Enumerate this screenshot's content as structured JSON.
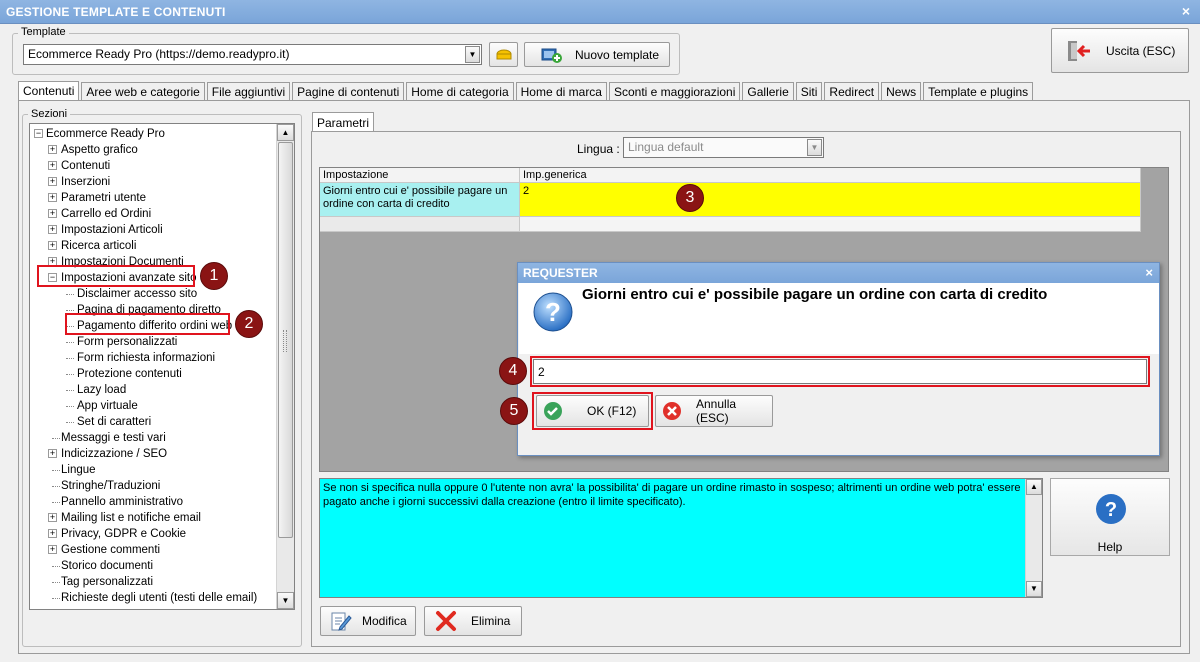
{
  "window": {
    "title": "GESTIONE TEMPLATE E CONTENUTI",
    "close_glyph": "×"
  },
  "template_group": {
    "label": "Template",
    "selected": "Ecommerce Ready Pro (https://demo.readypro.it)",
    "new_template_label": "Nuovo template"
  },
  "exit_button": {
    "label": "Uscita (ESC)"
  },
  "tabs": [
    {
      "label": "Contenuti",
      "active": true
    },
    {
      "label": "Aree web e categorie"
    },
    {
      "label": "File aggiuntivi"
    },
    {
      "label": "Pagine di contenuti"
    },
    {
      "label": "Home di categoria"
    },
    {
      "label": "Home di marca"
    },
    {
      "label": "Sconti e maggiorazioni"
    },
    {
      "label": "Gallerie"
    },
    {
      "label": "Siti"
    },
    {
      "label": "Redirect"
    },
    {
      "label": "News"
    },
    {
      "label": "Template e plugins"
    }
  ],
  "sections": {
    "label": "Sezioni",
    "tree": [
      {
        "label": "Ecommerce Ready Pro",
        "level": 0,
        "expander": "⊟"
      },
      {
        "label": "Aspetto grafico",
        "level": 1,
        "expander": "⊞"
      },
      {
        "label": "Contenuti",
        "level": 1,
        "expander": "⊞"
      },
      {
        "label": "Inserzioni",
        "level": 1,
        "expander": "⊞"
      },
      {
        "label": "Parametri utente",
        "level": 1,
        "expander": "⊞"
      },
      {
        "label": "Carrello ed Ordini",
        "level": 1,
        "expander": "⊞"
      },
      {
        "label": "Impostazioni Articoli",
        "level": 1,
        "expander": "⊞"
      },
      {
        "label": "Ricerca articoli",
        "level": 1,
        "expander": "⊞"
      },
      {
        "label": "Impostazioni Documenti",
        "level": 1,
        "expander": "⊞"
      },
      {
        "label": "Impostazioni avanzate sito",
        "level": 1,
        "expander": "⊟"
      },
      {
        "label": "Disclaimer accesso sito",
        "level": 2
      },
      {
        "label": "Pagina di pagamento diretto",
        "level": 2
      },
      {
        "label": "Pagamento differito ordini web",
        "level": 2
      },
      {
        "label": "Form personalizzati",
        "level": 2
      },
      {
        "label": "Form richiesta informazioni",
        "level": 2
      },
      {
        "label": "Protezione contenuti",
        "level": 2
      },
      {
        "label": "Lazy load",
        "level": 2
      },
      {
        "label": "App virtuale",
        "level": 2
      },
      {
        "label": "Set di caratteri",
        "level": 2
      },
      {
        "label": "Messaggi e testi vari",
        "level": 1
      },
      {
        "label": "Indicizzazione / SEO",
        "level": 1,
        "expander": "⊞"
      },
      {
        "label": "Lingue",
        "level": 1
      },
      {
        "label": "Stringhe/Traduzioni",
        "level": 1
      },
      {
        "label": "Pannello amministrativo",
        "level": 1
      },
      {
        "label": "Mailing list e notifiche email",
        "level": 1,
        "expander": "⊞"
      },
      {
        "label": "Privacy, GDPR e Cookie",
        "level": 1,
        "expander": "⊞"
      },
      {
        "label": "Gestione commenti",
        "level": 1,
        "expander": "⊞"
      },
      {
        "label": "Storico documenti",
        "level": 1
      },
      {
        "label": "Tag personalizzati",
        "level": 1
      },
      {
        "label": "Richieste degli utenti (testi delle email)",
        "level": 1
      }
    ]
  },
  "params": {
    "tab_label": "Parametri",
    "lingua_label": "Lingua :",
    "lingua_value": "Lingua default",
    "col_setting": "Impostazione",
    "col_value": "Imp.generica",
    "row_setting": "Giorni entro cui e' possibile pagare un ordine con carta di credito",
    "row_value": "2"
  },
  "dialog": {
    "title": "REQUESTER",
    "question": "Giorni entro cui e' possibile pagare un ordine con carta di credito",
    "input_value": "2",
    "ok_label": "OK (F12)",
    "cancel_label": "Annulla (ESC)"
  },
  "description": "Se non si specifica nulla oppure 0 l'utente non avra' la possibilita' di pagare un ordine rimasto in sospeso; altrimenti un ordine web potra' essere pagato anche i giorni successivi dalla creazione (entro il limite specificato).",
  "buttons": {
    "help": "Help",
    "modifica": "Modifica",
    "elimina": "Elimina"
  },
  "badges": [
    "1",
    "2",
    "3",
    "4",
    "5"
  ],
  "colors": {
    "highlight_yellow": "#ffff00",
    "setting_cyan": "#a8f0f0",
    "description_cyan": "#00ffff",
    "annotation_red": "#e0141e",
    "badge_dark_red": "#8a1414"
  },
  "icons": {
    "open_template": "folder-icon",
    "new_template": "add-template-icon",
    "exit": "exit-door-icon",
    "question": "question-icon",
    "ok": "check-icon",
    "cancel": "cancel-x-icon",
    "help": "help-icon",
    "modifica": "edit-icon",
    "elimina": "delete-x-icon"
  }
}
